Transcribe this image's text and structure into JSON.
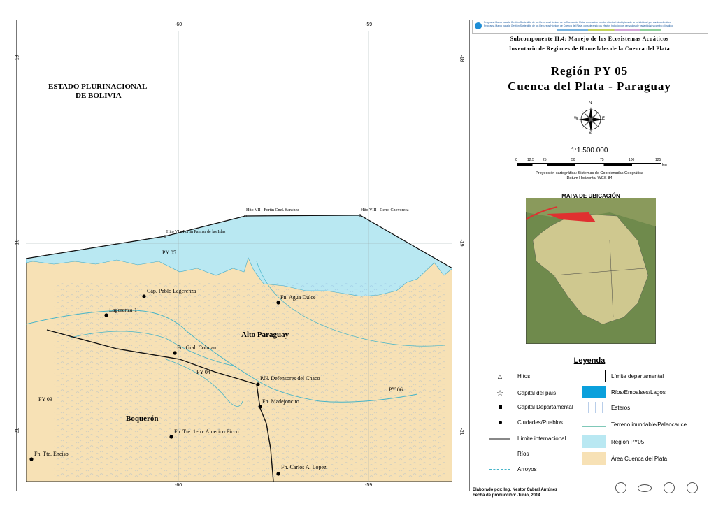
{
  "map": {
    "ticks_top": [
      "-60",
      "-59"
    ],
    "ticks_bottom": [
      "-60",
      "-59"
    ],
    "ticks_left": [
      "-18",
      "-19",
      "-21"
    ],
    "ticks_right": [
      "-18",
      "-19",
      "-21"
    ],
    "country_label_1": "ESTADO PLURINACIONAL",
    "country_label_2": "DE BOLIVIA",
    "region_label": "PY 05",
    "dept_alto": "Alto Paraguay",
    "dept_boqueron": "Boquerón",
    "py03": "PY 03",
    "py04": "PY 04",
    "py06": "PY 06",
    "hito_vi": "Hito VI - Fortín Palmar de las Islas",
    "hito_vii": "Hito VII - Fortín Cnel. Sanchez",
    "hito_viii": "Hito VIII - Cerro Chovoreca",
    "towns": [
      "Cap. Pablo Lagerenza",
      "Lagerenza-1",
      "Fn. Agua Dulce",
      "Fn. Gral. Colman",
      "P.N. Defensores del Chaco",
      "Fn. Madejoncito",
      "Fn. Tte. 1ero. Americo Picco",
      "Fn. Tte. Enciso",
      "Fn. Carlos A. López"
    ]
  },
  "header": {
    "banner_line1": "Programa Marco para la Gestión Sostenible de los Recursos Hídricos de la Cuenca del Plata, en relación con los efectos hidrológicos de la variabilidad y el cambio climático",
    "banner_line2": "Programa Marco para la Gestión Sostenible de los Recursos Hídricos de Cuenca del Plata, considerando los efectos hidrológicos derivados de variabilidad y cambio climático",
    "subcomponent": "Subcomponente II.4: Manejo de los Ecosistemas Acuáticos",
    "inventory": "Inventario de Regiones de Humedales de la Cuenca del Plata",
    "title1": "Región PY 05",
    "title2": "Cuenca del Plata - Paraguay"
  },
  "compass": {
    "n": "N",
    "s": "S",
    "e": "E",
    "w": "W"
  },
  "scale": {
    "ratio": "1:1.500.000",
    "ticks": [
      "0",
      "12,5",
      "25",
      "50",
      "75",
      "100",
      "125"
    ],
    "unit": "km",
    "projection": "Proyección cartográfica: Sistemas de Coordenadas Geográfica",
    "datum": "Datum Horizontal  WGS-84"
  },
  "location_map": {
    "title": "MAPA DE UBICACIÓN"
  },
  "legend": {
    "title": "Leyenda",
    "left": [
      "Hitos",
      "Capital del país",
      "Capital Departamental",
      "Ciudades/Pueblos",
      "Límite internacional",
      "Ríos",
      "Arroyos"
    ],
    "right": [
      "Límite departamental",
      "Ríos/Embalses/Lagos",
      "Esteros",
      "Terreno inundable/Paleocauce",
      "Región PY05",
      "Área Cuenca del Plata"
    ]
  },
  "footer": {
    "author": "Elaborado por: Ing. Nestor Cabral Antúnez",
    "date": "Fecha de producción: Junio, 2014."
  },
  "colors": {
    "basin": "#f7e1b5",
    "region": "#b9e8f2",
    "water": "#0aa0dc",
    "river": "#46b4c8"
  }
}
